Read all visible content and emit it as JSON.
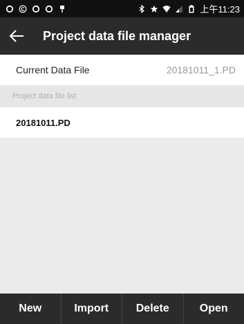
{
  "status_bar": {
    "clock": "上午11:23",
    "icons": [
      "refresh-icon",
      "copyright-icon",
      "refresh-icon",
      "refresh-icon",
      "usb-icon",
      "bluetooth-icon",
      "star-icon",
      "wifi-icon",
      "signal-icon",
      "battery-icon"
    ]
  },
  "header": {
    "title": "Project data file manager",
    "back_icon": "arrow-left-icon"
  },
  "current_file": {
    "label": "Current Data File",
    "value": "20181011_1.PD"
  },
  "file_list": {
    "header": "Project data file list",
    "items": [
      {
        "name": "20181011.PD"
      }
    ]
  },
  "bottom_bar": {
    "buttons": [
      "New",
      "Import",
      "Delete",
      "Open"
    ]
  },
  "colors": {
    "bar_dark": "#2b2b2b",
    "status_bar": "#111111",
    "background": "#ebebeb",
    "muted_text": "#999999"
  }
}
